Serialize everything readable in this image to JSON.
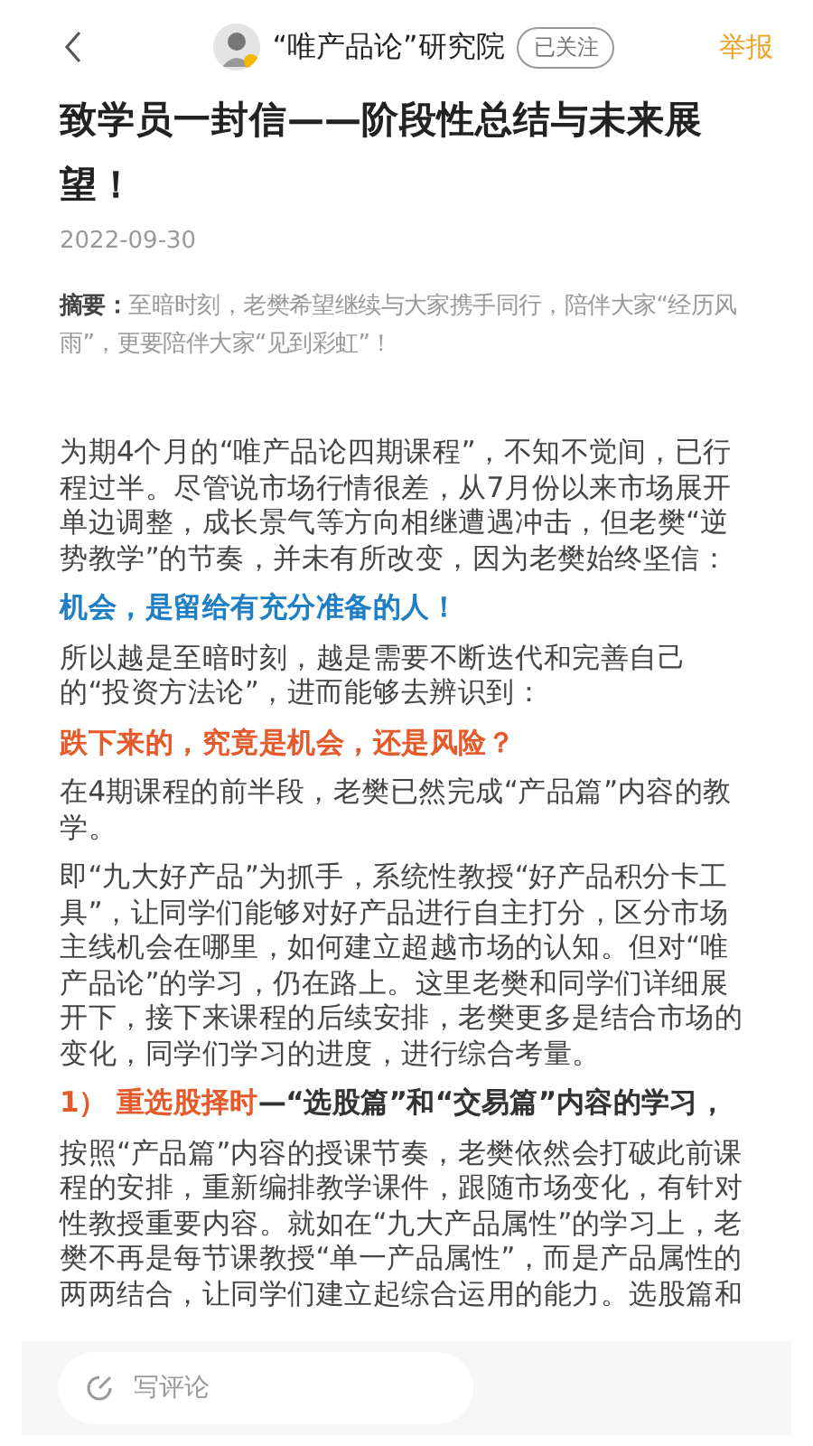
{
  "header": {
    "author": "“唯产品论”研究院",
    "follow_label": "已关注",
    "report_label": "举报"
  },
  "article": {
    "title": "致学员一封信——阶段性总结与未来展望！",
    "date": "2022-09-30",
    "summary": {
      "label": "摘要：",
      "text": "至暗时刻，老樊希望继续与大家携手同行，陪伴大家“经历风雨”，更要陪伴大家“见到彩虹”！"
    },
    "blocks": [
      {
        "kind": "paragraph",
        "text": "为期4个月的“唯产品论四期课程”，不知不觉间，已行程过半。尽管说市场行情很差，从7月份以来市场展开单边调整，成长景气等方向相继遭遇冲击，但老樊“逆势教学”的节奏，并未有所改变，因为老樊始终坚信："
      },
      {
        "kind": "blue_heading",
        "text": "机会，是留给有充分准备的人！"
      },
      {
        "kind": "paragraph",
        "text": "所以越是至暗时刻，越是需要不断迭代和完善自己的“投资方法论”，进而能够去辨识到："
      },
      {
        "kind": "orange_heading",
        "text": "跌下来的，究竟是机会，还是风险？"
      },
      {
        "kind": "paragraph",
        "text": "在4期课程的前半段，老樊已然完成“产品篇”内容的教学。"
      },
      {
        "kind": "paragraph",
        "text": "即“九大好产品”为抓手，系统性教授“好产品积分卡工具”，让同学们能够对好产品进行自主打分，区分市场主线机会在哪里，如何建立超越市场的认知。但对“唯产品论”的学习，仍在路上。这里老樊和同学们详细展开下，接下来课程的后续安排，老樊更多是结合市场的变化，同学们学习的进度，进行综合考量。"
      },
      {
        "kind": "numbered_heading",
        "lead": "1） 重选股择时",
        "text": "—“选股篇”和“交易篇”内容的学习，"
      },
      {
        "kind": "paragraph",
        "text": "按照“产品篇”内容的授课节奏，老樊依然会打破此前课程的安排，重新编排教学课件，跟随市场变化，有针对性教授重要内容。就如在“九大产品属性”的学习上，老樊不再是每节课教授“单一产品属性”，而是产品属性的两两结合，让同学们建立起综合运用的能力。选股篇和"
      }
    ]
  },
  "comment_bar": {
    "placeholder": "写评论"
  }
}
